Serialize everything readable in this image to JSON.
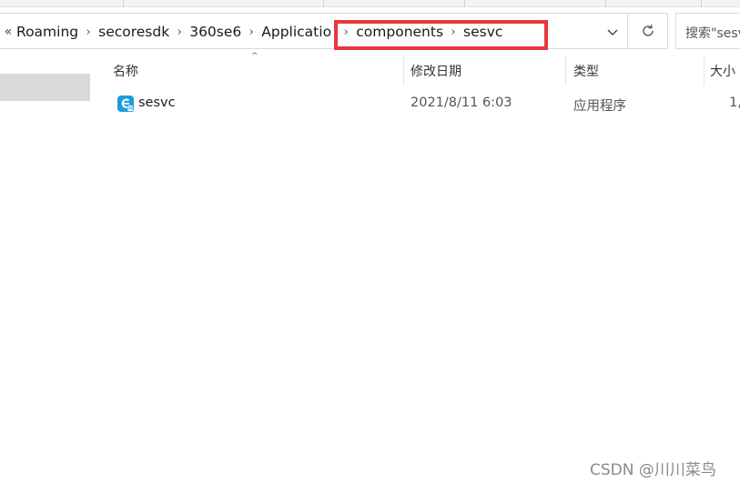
{
  "breadcrumb": {
    "overflow": "«",
    "items": [
      "Roaming",
      "secoresdk",
      "360se6",
      "Application",
      "components",
      "sesvc"
    ]
  },
  "search": {
    "placeholder": "搜索\"sesvc\""
  },
  "columns": {
    "name": "名称",
    "modified": "修改日期",
    "type": "类型",
    "size": "大小"
  },
  "files": [
    {
      "name": "sesvc",
      "modified": "2021/8/11 6:03",
      "type": "应用程序",
      "size": "1,"
    }
  ],
  "watermark": "CSDN @川川菜鸟",
  "colors": {
    "highlight": "#e8373d",
    "selection": "#d9d9d9"
  }
}
